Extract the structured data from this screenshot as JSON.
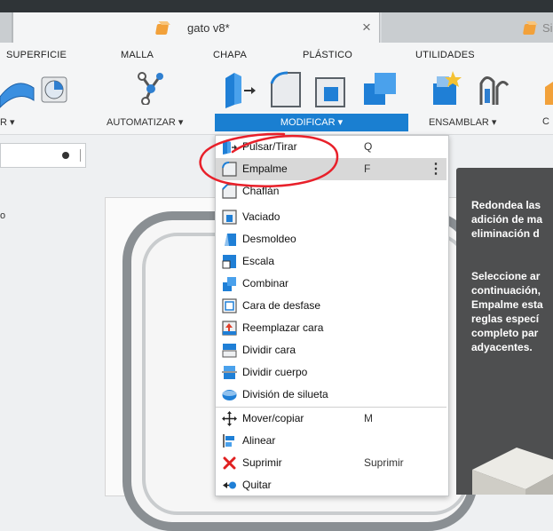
{
  "document_tab": {
    "title": "gato v8*",
    "close": "×",
    "next_tab_label": "Si"
  },
  "workspace_tabs": [
    "SUPERFICIE",
    "MALLA",
    "CHAPA",
    "PLÁSTICO",
    "UTILIDADES"
  ],
  "groups": {
    "left_cut": "R ▾",
    "automate": "AUTOMATIZAR ▾",
    "modify": "MODIFICAR ▾",
    "assemble": "ENSAMBLAR ▾",
    "right_cut": "C"
  },
  "left_panel": {
    "partial_label": "o"
  },
  "menu": {
    "items": [
      {
        "label": "Pulsar/Tirar",
        "shortcut": "Q",
        "icon": "press-pull-icon"
      },
      {
        "label": "Empalme",
        "shortcut": "F",
        "icon": "fillet-icon",
        "highlighted": true
      },
      {
        "label": "Chaflán",
        "shortcut": "",
        "icon": "chamfer-icon"
      },
      {
        "label": "Vaciado",
        "shortcut": "",
        "icon": "shell-icon"
      },
      {
        "label": "Desmoldeo",
        "shortcut": "",
        "icon": "draft-icon"
      },
      {
        "label": "Escala",
        "shortcut": "",
        "icon": "scale-icon"
      },
      {
        "label": "Combinar",
        "shortcut": "",
        "icon": "combine-icon"
      },
      {
        "label": "Cara de desfase",
        "shortcut": "",
        "icon": "offset-face-icon"
      },
      {
        "label": "Reemplazar cara",
        "shortcut": "",
        "icon": "replace-face-icon"
      },
      {
        "label": "Dividir cara",
        "shortcut": "",
        "icon": "split-face-icon"
      },
      {
        "label": "Dividir cuerpo",
        "shortcut": "",
        "icon": "split-body-icon"
      },
      {
        "label": "División de silueta",
        "shortcut": "",
        "icon": "silhouette-split-icon"
      },
      {
        "label": "Mover/copiar",
        "shortcut": "M",
        "icon": "move-icon"
      },
      {
        "label": "Alinear",
        "shortcut": "",
        "icon": "align-icon"
      },
      {
        "label": "Suprimir",
        "shortcut": "Suprimir",
        "icon": "delete-icon"
      },
      {
        "label": "Quitar",
        "shortcut": "",
        "icon": "remove-icon"
      }
    ],
    "more_glyph": "⋮"
  },
  "tooltip": {
    "para1": [
      "Redondea las",
      "adición de ma",
      "eliminación d"
    ],
    "para2": [
      "Seleccione ar",
      "continuación,",
      "Empalme esta",
      "reglas especí",
      "completo par",
      "adyacentes."
    ]
  },
  "colors": {
    "accent": "#1a7fd1",
    "icon_blue": "#1f7fd6",
    "annotation_red": "#e8202a",
    "tooltip_bg": "#4e4f50",
    "delete_red": "#e02020"
  }
}
